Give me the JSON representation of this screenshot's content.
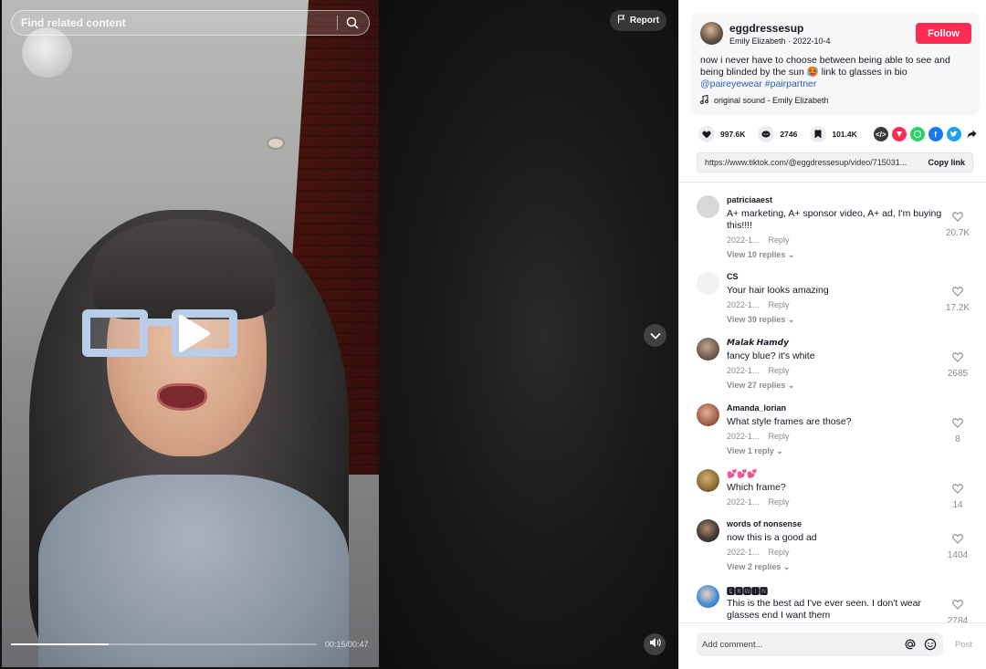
{
  "video": {
    "search_placeholder": "Find related content",
    "report_label": "Report",
    "timecode": "00:15/00:47",
    "progress_percent": 31.9
  },
  "author": {
    "username": "eggdressesup",
    "display_name": "Emily Elizabeth",
    "date": "2022-10-4",
    "follow_label": "Follow",
    "caption": "now i never have to choose between being able to see and being blinded by the sun 🥵 link to glasses in bio",
    "tags": "@paireyewear #pairpartner",
    "sound": "original sound - Emily Elizabeth"
  },
  "stats": {
    "likes": "997.6K",
    "comments": "2746",
    "saves": "101.4K"
  },
  "link": {
    "url": "https://www.tiktok.com/@eggdressesup/video/715031...",
    "copy_label": "Copy link"
  },
  "comments": [
    {
      "user": "patriciaaest",
      "text": "A+ marketing, A+ sponsor video, A+ ad, I'm buying this!!!!",
      "date": "2022-1...",
      "reply": "Reply",
      "replies": "View 10 replies",
      "likes": "20.7K",
      "avatar_color": "#d8d8d8"
    },
    {
      "user": "CS",
      "text": "Your hair looks amazing",
      "date": "2022-1...",
      "reply": "Reply",
      "replies": "View 39 replies",
      "likes": "17.2K",
      "avatar_color": "#f2f2f2"
    },
    {
      "user": "𝙈𝙖𝙡𝙖𝙠 𝙃𝙖𝙢𝙙𝙮",
      "text": "fancy blue? it's white",
      "date": "2022-1...",
      "reply": "Reply",
      "replies": "View 27 replies",
      "likes": "2685",
      "avatar_color": "#6b5a50"
    },
    {
      "user": "Amanda_lorian",
      "text": "What style frames are those?",
      "date": "2022-1...",
      "reply": "Reply",
      "replies": "View 1 reply",
      "likes": "8",
      "avatar_color": "#a0604a"
    },
    {
      "user": "💕💕💕",
      "text": "Which frame?",
      "date": "2022-1...",
      "reply": "Reply",
      "replies": "",
      "likes": "14",
      "avatar_color": "#8a6a3a"
    },
    {
      "user": "words of nonsense",
      "text": "now this is a good ad",
      "date": "2022-1...",
      "reply": "Reply",
      "replies": "View 2 replies",
      "likes": "1404",
      "avatar_color": "#3e3530"
    },
    {
      "user": "🅴🆁🆆🅸🅽",
      "text": "This is the best ad I've ever seen. I don't wear glasses end I want them",
      "date": "",
      "reply": "",
      "replies": "",
      "likes": "2784",
      "avatar_color": "#4a8fd8"
    }
  ],
  "comment_bar": {
    "placeholder": "Add comment...",
    "post_label": "Post"
  },
  "colors": {
    "accent": "#fe2c55",
    "tag": "#2b5db9"
  }
}
